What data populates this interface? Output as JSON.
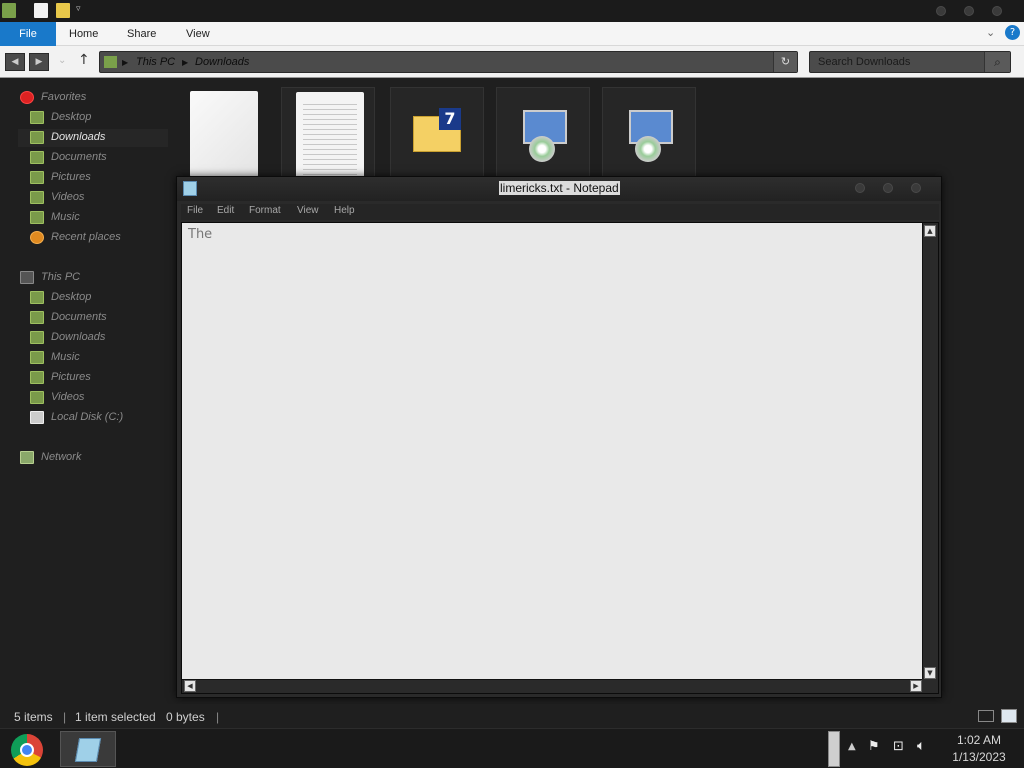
{
  "explorer": {
    "ribbon_tabs": [
      "File",
      "Home",
      "Share",
      "View"
    ],
    "breadcrumb": [
      "This PC",
      "Downloads"
    ],
    "search_placeholder": "Search Downloads",
    "nav": {
      "favorites_header": "Favorites",
      "favorites": [
        "Desktop",
        "Downloads",
        "Documents",
        "Pictures",
        "Videos",
        "Music",
        "Recent places"
      ],
      "thispc_header": "This PC",
      "thispc": [
        "Desktop",
        "Documents",
        "Downloads",
        "Music",
        "Pictures",
        "Videos",
        "Local Disk (C:)"
      ],
      "network": "Network"
    },
    "status": {
      "items": "5 items",
      "selected": "1 item selected",
      "size": "0 bytes"
    }
  },
  "notepad": {
    "title": "limericks.txt - Notepad",
    "menus": [
      "File",
      "Edit",
      "Format",
      "View",
      "Help"
    ],
    "content": "The"
  },
  "taskbar": {
    "time": "1:02 AM",
    "date": "1/13/2023"
  }
}
